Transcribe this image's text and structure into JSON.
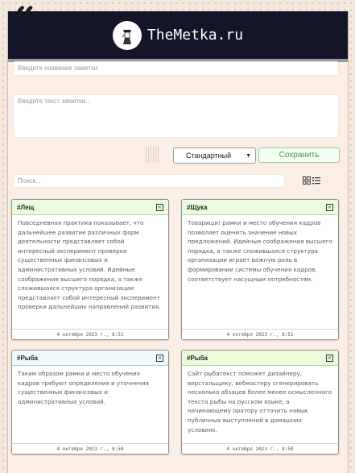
{
  "site": {
    "name": "TheMetka.ru"
  },
  "form": {
    "title_placeholder": "Введите название заметки",
    "text_placeholder": "Введите текст заметки...",
    "type_select": {
      "selected": "Стандартный"
    },
    "save_label": "Сохранить"
  },
  "search": {
    "placeholder": "Поиск..."
  },
  "notes": [
    {
      "tag": "#Лещ",
      "text": "Повседневная практика показывает, что дальнейшее развитие различных форм деятельности представляет собой интересный эксперимент проверки существенных финансовых и административных условий. Идейные соображения высшего порядка, а также сложившаяся структура организации представляет собой интересный эксперимент проверки дальнейших направлений развития.",
      "date": "4 октября 2023 г., 8:51",
      "close": "×"
    },
    {
      "tag": "#Щука",
      "text": "Товарищи! рамки и место обучения кадров позволяет оценить значение новых предложений. Идейные соображения высшего порядка, а также сложившаяся структура организации играет важную роль в формировании системы обучения кадров, соответствует насущным потребностям.",
      "date": "4 октября 2023 г., 8:51",
      "close": "×"
    },
    {
      "tag": "#Рыба",
      "text": "Таким образом рамки и место обучения кадров требуют определения и уточнения существенных финансовых и административных условий.",
      "date": "4 октября 2023 г., 8:50",
      "close": "×"
    },
    {
      "tag": "#Рыба",
      "text": "Сайт рыбатекст поможет дизайнеру, верстальщику, вебмастеру сгенерировать несколько абзацев более менее осмысленного текста рыбы на русском языке, а начинающему оратору отточить навык публичных выступлений в домашних условиях.",
      "date": "4 октября 2023 г., 8:50",
      "close": "×"
    }
  ],
  "colors": {
    "header_bg": "#14142b",
    "save_green": "#3e9d3e",
    "note_header_green": "#ecfbdc",
    "note_header_blue": "#f0f9fc"
  },
  "icons": {
    "quote": "quote-icon",
    "logo": "logo-avatar",
    "view_toggle": "grid-list-icon"
  },
  "quote_glyph": "“"
}
